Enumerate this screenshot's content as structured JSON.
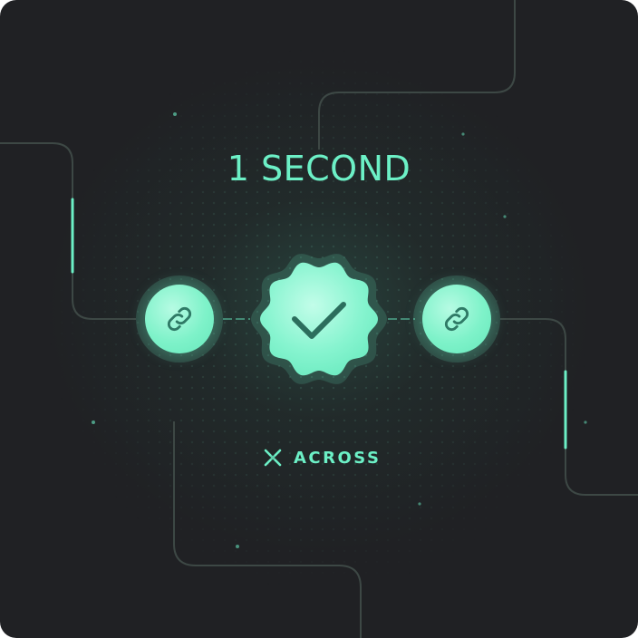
{
  "headline": "1 SECOND",
  "brand": {
    "name": "ACROSS",
    "logo_icon": "across-x-logo-icon"
  },
  "nodes": [
    {
      "icon": "chain-link-icon"
    },
    {
      "icon": "check-badge-icon"
    },
    {
      "icon": "chain-link-icon"
    }
  ],
  "colors": {
    "background": "#202124",
    "accent": "#6cf0c6",
    "accent_light": "#b6fbe3",
    "line": "#3b4a46"
  }
}
